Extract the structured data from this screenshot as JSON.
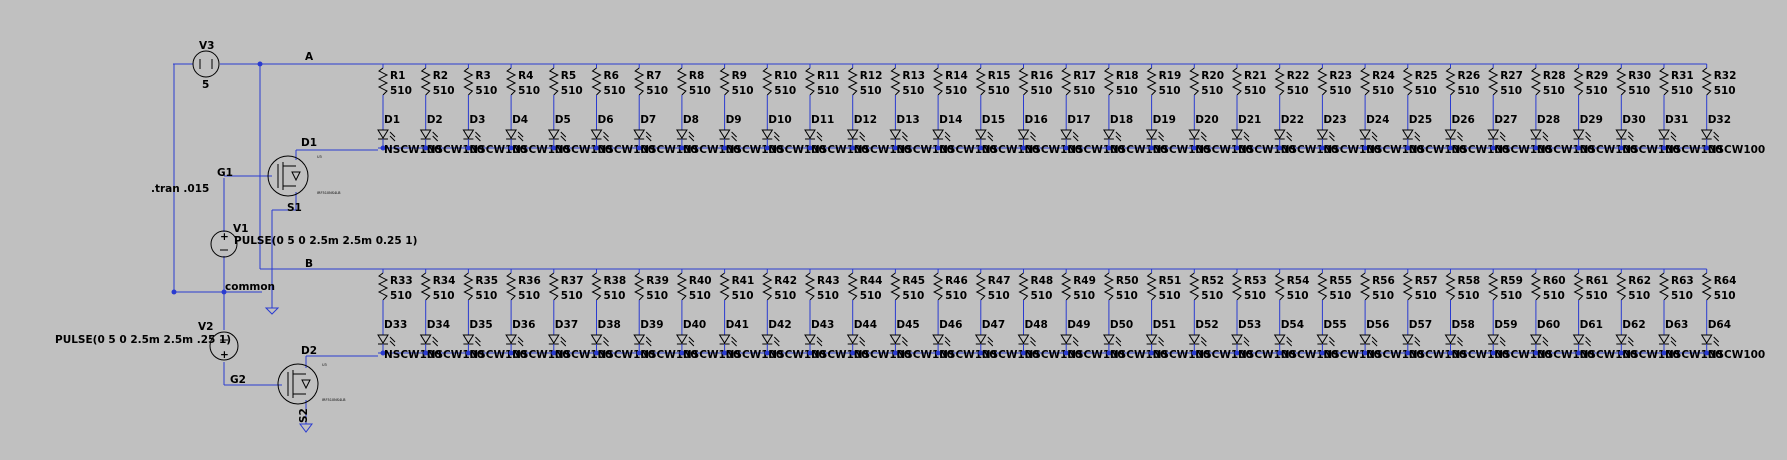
{
  "directive": ".tran .015",
  "sources": {
    "v3": {
      "name": "V3",
      "value": "5"
    },
    "v1": {
      "name": "V1",
      "value": "PULSE(0 5 0 2.5m 2.5m 0.25 1)"
    },
    "v2": {
      "name": "V2",
      "value": "PULSE(0 5 0 2.5m 2.5m .25 1)"
    }
  },
  "nets": {
    "a": "A",
    "b": "B",
    "common": "common",
    "g1": "G1",
    "g2": "G2"
  },
  "mosfets": [
    {
      "drain": "D1",
      "source": "S1",
      "pin": "U3",
      "model": "IRF510NS4LB"
    },
    {
      "drain": "D2",
      "source": "S2",
      "pin": "U3",
      "model": "IRF510NS4LB"
    }
  ],
  "rows": [
    {
      "resistors": [
        "R1",
        "R2",
        "R3",
        "R4",
        "R5",
        "R6",
        "R7",
        "R8",
        "R9",
        "R10",
        "R11",
        "R12",
        "R13",
        "R14",
        "R15",
        "R16",
        "R17",
        "R18",
        "R19",
        "R20",
        "R21",
        "R22",
        "R23",
        "R24",
        "R25",
        "R26",
        "R27",
        "R28",
        "R29",
        "R30",
        "R31",
        "R32"
      ],
      "diodes": [
        "D1",
        "D2",
        "D3",
        "D4",
        "D5",
        "D6",
        "D7",
        "D8",
        "D9",
        "D10",
        "D11",
        "D12",
        "D13",
        "D14",
        "D15",
        "D16",
        "D17",
        "D18",
        "D19",
        "D20",
        "D21",
        "D22",
        "D23",
        "D24",
        "D25",
        "D26",
        "D27",
        "D28",
        "D29",
        "D30",
        "D31",
        "D32"
      ]
    },
    {
      "resistors": [
        "R33",
        "R34",
        "R35",
        "R36",
        "R37",
        "R38",
        "R39",
        "R40",
        "R41",
        "R42",
        "R43",
        "R44",
        "R45",
        "R46",
        "R47",
        "R48",
        "R49",
        "R50",
        "R51",
        "R52",
        "R53",
        "R54",
        "R55",
        "R56",
        "R57",
        "R58",
        "R59",
        "R60",
        "R61",
        "R62",
        "R63",
        "R64"
      ],
      "diodes": [
        "D33",
        "D34",
        "D35",
        "D36",
        "D37",
        "D38",
        "D39",
        "D40",
        "D41",
        "D42",
        "D43",
        "D44",
        "D45",
        "D46",
        "D47",
        "D48",
        "D49",
        "D50",
        "D51",
        "D52",
        "D53",
        "D54",
        "D55",
        "D56",
        "D57",
        "D58",
        "D59",
        "D60",
        "D61",
        "D62",
        "D63",
        "D64"
      ]
    }
  ],
  "resistor_value": "510",
  "led_model": "NSCW100"
}
